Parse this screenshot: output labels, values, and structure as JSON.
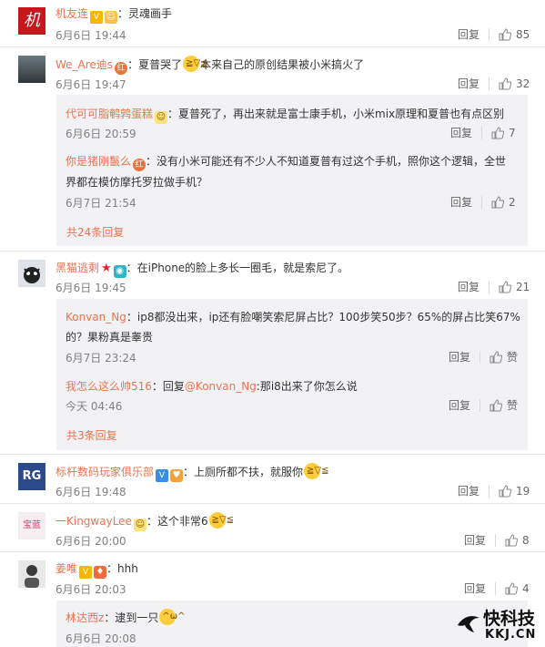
{
  "comments": [
    {
      "user": "机友连",
      "text": "：灵魂画手",
      "time": "6月6日 19:44",
      "reply": "回复",
      "likes": "85"
    },
    {
      "user": "We_Are迪s",
      "text1": "：夏普哭了",
      "text2": "本来自己的原创结果被小米搞火了",
      "time": "6月6日 19:47",
      "reply": "回复",
      "likes": "32"
    },
    {
      "user": "黑猫逃剩",
      "text": "：在iPhone的脸上多长一圈毛，就是索尼了。",
      "time": "6月6日 19:45",
      "reply": "回复",
      "likes": "21"
    },
    {
      "user": "标杆数码玩家俱乐部",
      "text": "：上厕所都不扶，就服你",
      "time": "6月6日 19:48",
      "reply": "回复",
      "likes": "19"
    },
    {
      "user": "一KingwayLee",
      "text": "：这个非常6",
      "time": "6月6日 20:00",
      "reply": "回复",
      "likes": "8"
    },
    {
      "user": "姜唯",
      "text": "：hhh",
      "time": "6月6日 20:03",
      "reply": "回复",
      "likes": "4"
    }
  ],
  "subs1": [
    {
      "user": "代可可脂鹌鹑蛋糕",
      "text": "：夏普死了，再出来就是富士康手机，小米mix原理和夏普也有点区别",
      "time": "6月6日 20:59",
      "reply": "回复",
      "likes": "7"
    },
    {
      "user": "你是猪刚鬣么",
      "text1": "：没有小米可能还有不少人不知道夏普有过这个手机，照你这个逻辑，全世",
      "text2": "界都在模仿摩托罗拉做手机？",
      "time": "6月7日 21:54",
      "reply": "回复",
      "likes": "2"
    }
  ],
  "more1": "共24条回复",
  "subs2": [
    {
      "user": "Konvan_Ng",
      "text1": "：ip8都没出来，ip还有脸嘲笑索尼屏占比？100步笑50步？65%的屏占比笑67%",
      "text2": "的？果粉真是睾贵",
      "time": "6月7日 23:24",
      "reply": "回复",
      "likes": "赞"
    },
    {
      "user": "我怎么这么帅516",
      "text_a": "：回复",
      "mention": "@Konvan_Ng",
      "text_b": ":那i8出来了你怎么说",
      "time": "今天 04:46",
      "reply": "回复",
      "likes": "赞"
    }
  ],
  "more2": "共3条回复",
  "sub3": {
    "user": "林达西z",
    "text": "：逮到一只",
    "time": "6月6日 20:08"
  },
  "avatar_text": {
    "a1": "机",
    "a4": "RG",
    "a5": "宝蓝"
  },
  "watermark": {
    "name": "快科技",
    "url": "KKJ.CN"
  },
  "colors": {
    "username": "#eb7350",
    "subbg": "#f2f2f5",
    "vip": "#f7b600"
  }
}
